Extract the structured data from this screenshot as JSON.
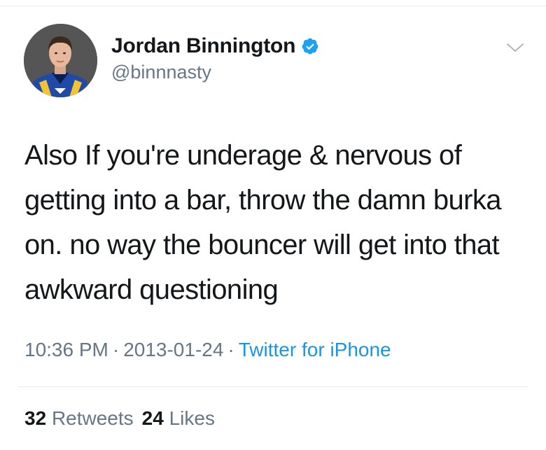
{
  "tweet": {
    "author": {
      "display_name": "Jordan Binnington",
      "handle": "@binnnasty",
      "verified": true
    },
    "text": "Also If you're underage & nervous of getting into a bar, throw the damn burka on. no way the bouncer will get into that awkward questioning",
    "time": "10:36 PM",
    "date": "2013-01-24",
    "separator": "·",
    "source": "Twitter for iPhone",
    "stats": {
      "retweets_count": "32",
      "retweets_label": "Retweets",
      "likes_count": "24",
      "likes_label": "Likes"
    }
  },
  "colors": {
    "text_primary": "#14171a",
    "text_secondary": "#657786",
    "link": "#1b95e0",
    "verified": "#1da1f2",
    "divider": "#e6ecf0"
  },
  "icons": {
    "verified": "verified-badge-icon",
    "menu": "chevron-down-icon"
  }
}
